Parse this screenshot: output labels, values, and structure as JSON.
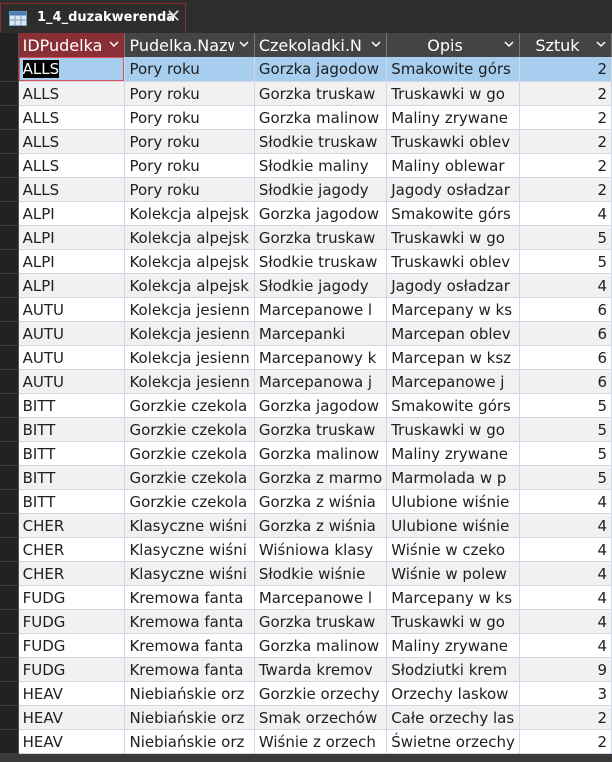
{
  "tab": {
    "title": "1_4_duzakwerenda",
    "icon": "query-datasheet-icon",
    "close_label": "✕"
  },
  "columns": [
    "IDPudelka",
    "Pudelka.Nazw",
    "Czekoladki.N",
    "Opis",
    "Sztuk"
  ],
  "rows": [
    [
      "ALLS",
      "Pory roku",
      "Gorzka jagodow",
      "Smakowite górs",
      "2"
    ],
    [
      "ALLS",
      "Pory roku",
      "Gorzka truskaw",
      "Truskawki w go",
      "2"
    ],
    [
      "ALLS",
      "Pory roku",
      "Gorzka malinow",
      "Maliny zrywane",
      "2"
    ],
    [
      "ALLS",
      "Pory roku",
      "Słodkie truskaw",
      "Truskawki oblev",
      "2"
    ],
    [
      "ALLS",
      "Pory roku",
      "Słodkie maliny",
      "Maliny oblewar",
      "2"
    ],
    [
      "ALLS",
      "Pory roku",
      "Słodkie jagody",
      "Jagody osładzar",
      "2"
    ],
    [
      "ALPI",
      "Kolekcja alpejsk",
      "Gorzka jagodow",
      "Smakowite górs",
      "4"
    ],
    [
      "ALPI",
      "Kolekcja alpejsk",
      "Gorzka truskaw",
      "Truskawki w go",
      "5"
    ],
    [
      "ALPI",
      "Kolekcja alpejsk",
      "Słodkie truskaw",
      "Truskawki oblev",
      "5"
    ],
    [
      "ALPI",
      "Kolekcja alpejsk",
      "Słodkie jagody",
      "Jagody osładzar",
      "4"
    ],
    [
      "AUTU",
      "Kolekcja jesienn",
      "Marcepanowe l",
      "Marcepany w ks",
      "6"
    ],
    [
      "AUTU",
      "Kolekcja jesienn",
      "Marcepanki",
      "Marcepan oblev",
      "6"
    ],
    [
      "AUTU",
      "Kolekcja jesienn",
      "Marcepanowy k",
      "Marcepan w ksz",
      "6"
    ],
    [
      "AUTU",
      "Kolekcja jesienn",
      "Marcepanowa j",
      "Marcepanowe j",
      "6"
    ],
    [
      "BITT",
      "Gorzkie czekola",
      "Gorzka jagodow",
      "Smakowite górs",
      "5"
    ],
    [
      "BITT",
      "Gorzkie czekola",
      "Gorzka truskaw",
      "Truskawki w go",
      "5"
    ],
    [
      "BITT",
      "Gorzkie czekola",
      "Gorzka malinow",
      "Maliny zrywane",
      "5"
    ],
    [
      "BITT",
      "Gorzkie czekola",
      "Gorzka z marmo",
      "Marmolada w p",
      "5"
    ],
    [
      "BITT",
      "Gorzkie czekola",
      "Gorzka z wiśnia",
      "Ulubione wiśnie",
      "4"
    ],
    [
      "CHER",
      "Klasyczne wiśni",
      "Gorzka z wiśnia",
      "Ulubione wiśnie",
      "4"
    ],
    [
      "CHER",
      "Klasyczne wiśni",
      "Wiśniowa klasy",
      "Wiśnie w czeko",
      "4"
    ],
    [
      "CHER",
      "Klasyczne wiśni",
      "Słodkie wiśnie",
      "Wiśnie w polew",
      "4"
    ],
    [
      "FUDG",
      "Kremowa fanta",
      "Marcepanowe l",
      "Marcepany w ks",
      "4"
    ],
    [
      "FUDG",
      "Kremowa fanta",
      "Gorzka truskaw",
      "Truskawki w go",
      "4"
    ],
    [
      "FUDG",
      "Kremowa fanta",
      "Gorzka malinow",
      "Maliny zrywane",
      "4"
    ],
    [
      "FUDG",
      "Kremowa fanta",
      "Twarda kremov",
      "Słodziutki krem",
      "9"
    ],
    [
      "HEAV",
      "Niebiańskie orz",
      "Gorzkie orzechy",
      "Orzechy laskow",
      "3"
    ],
    [
      "HEAV",
      "Niebiańskie orz",
      "Smak orzechów",
      "Całe orzechy las",
      "2"
    ],
    [
      "HEAV",
      "Niebiańskie orz",
      "Wiśnie z orzech",
      "Świetne orzechy",
      "2"
    ]
  ],
  "colors": {
    "accent": "#8a2f36",
    "selected_row": "#a7cdef",
    "header": "#444444"
  }
}
